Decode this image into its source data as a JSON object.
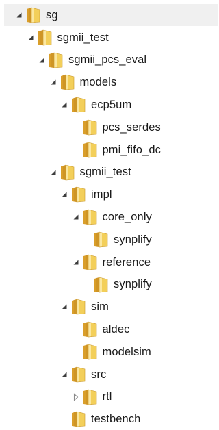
{
  "tree": {
    "nodes": [
      {
        "label": "sg",
        "state": "expanded",
        "level": 0,
        "selected": true
      },
      {
        "label": "sgmii_test",
        "state": "expanded",
        "level": 1
      },
      {
        "label": "sgmii_pcs_eval",
        "state": "expanded",
        "level": 2
      },
      {
        "label": "models",
        "state": "expanded",
        "level": 3
      },
      {
        "label": "ecp5um",
        "state": "expanded",
        "level": 4
      },
      {
        "label": "pcs_serdes",
        "state": "leaf",
        "level": 5
      },
      {
        "label": "pmi_fifo_dc",
        "state": "leaf",
        "level": 5
      },
      {
        "label": "sgmii_test",
        "state": "expanded",
        "level": 3
      },
      {
        "label": "impl",
        "state": "expanded",
        "level": 4
      },
      {
        "label": "core_only",
        "state": "expanded",
        "level": 5
      },
      {
        "label": "synplify",
        "state": "leaf",
        "level": 6
      },
      {
        "label": "reference",
        "state": "expanded",
        "level": 5
      },
      {
        "label": "synplify",
        "state": "leaf",
        "level": 6
      },
      {
        "label": "sim",
        "state": "expanded",
        "level": 4
      },
      {
        "label": "aldec",
        "state": "leaf",
        "level": 5
      },
      {
        "label": "modelsim",
        "state": "leaf",
        "level": 5
      },
      {
        "label": "src",
        "state": "expanded",
        "level": 4
      },
      {
        "label": "rtl",
        "state": "collapsed",
        "level": 5
      },
      {
        "label": "testbench",
        "state": "leaf",
        "level": 4
      }
    ]
  },
  "colors": {
    "selection": "#f0f0f0",
    "folder_front": "#f3cf5a",
    "folder_back": "#d99e2a",
    "folder_light": "#fbe7a0",
    "expander_filled": "#3c3c3c",
    "expander_hollow": "#8a8a8a"
  }
}
